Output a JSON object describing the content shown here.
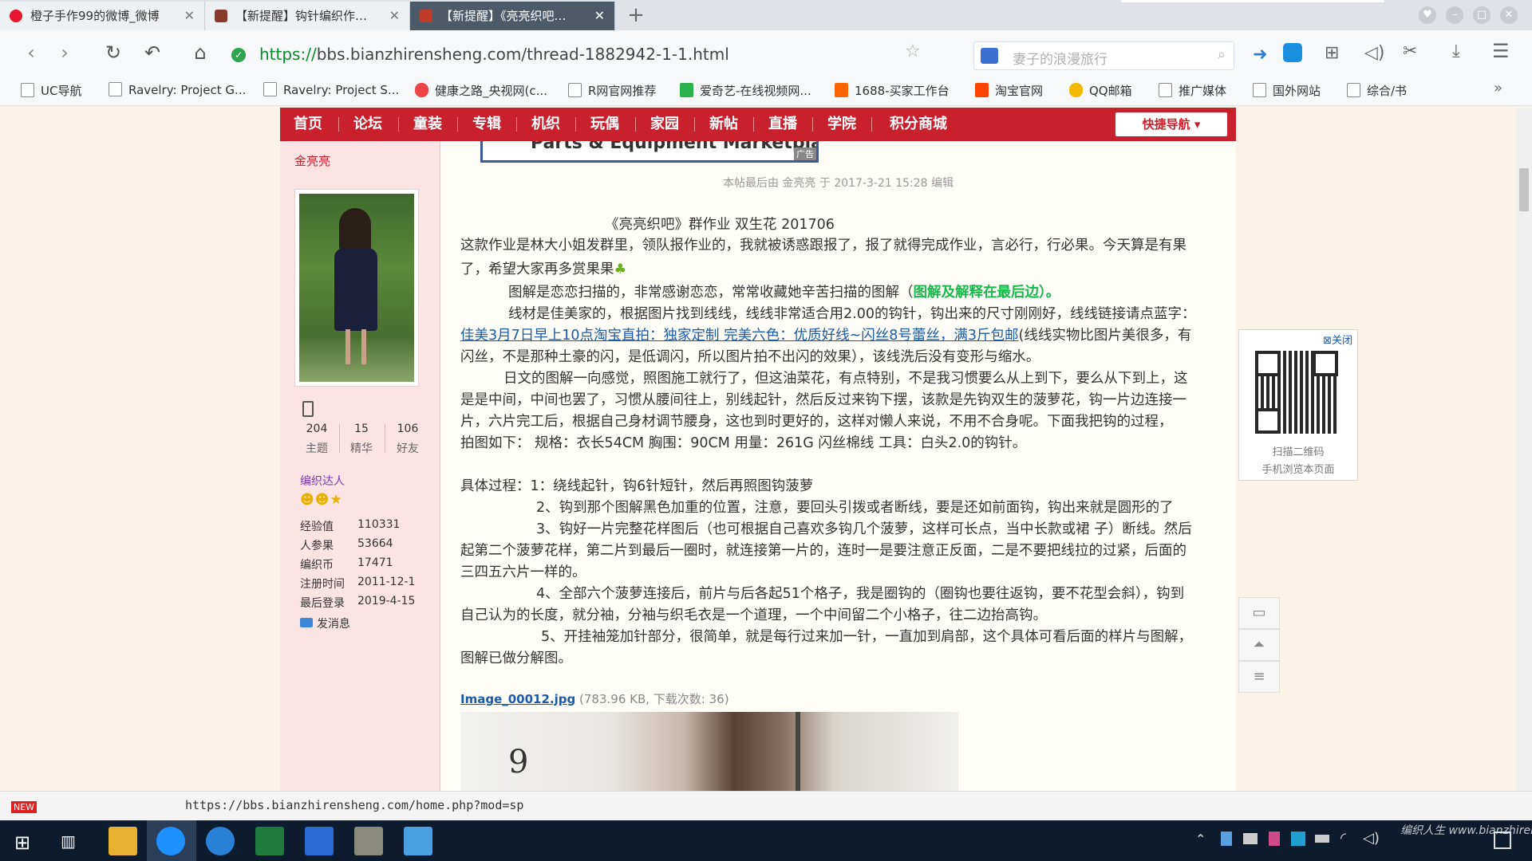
{
  "tabs": [
    {
      "label": "橙子手作99的微博_微博",
      "active": false
    },
    {
      "label": "【新提醒】钩针编织作…",
      "active": false
    },
    {
      "label": "【新提醒】《亮亮织吧…",
      "active": true
    }
  ],
  "address": {
    "scheme": "https://",
    "host_path": "bbs.bianzhirensheng.com/thread-1882942-1-1.html"
  },
  "search": {
    "placeholder": "妻子的浪漫旅行"
  },
  "bookmarks": [
    "UC导航",
    "Ravelry: Project G...",
    "Ravelry: Project S...",
    "健康之路_央视网(c...",
    "R网官网推荐",
    "爱奇艺-在线视频网...",
    "1688-买家工作台",
    "淘宝官网",
    "QQ邮箱",
    "推广媒体",
    "国外网站",
    "综合/书"
  ],
  "site_nav": {
    "items": [
      "首页",
      "论坛",
      "童装",
      "专辑",
      "机织",
      "玩偶",
      "家园",
      "新帖",
      "直播",
      "学院",
      "积分商城"
    ],
    "quick_nav": "快捷导航"
  },
  "ad_banner": {
    "text": "Parts & Equipment Marketplace",
    "tag": "广告"
  },
  "author": {
    "name": "金亮亮",
    "stats": [
      {
        "value": "204",
        "label": "主题"
      },
      {
        "value": "15",
        "label": "精华"
      },
      {
        "value": "106",
        "label": "好友"
      }
    ],
    "rank": "编织达人",
    "fields": [
      {
        "k": "经验值",
        "v": "110331"
      },
      {
        "k": "人参果",
        "v": "53664"
      },
      {
        "k": "编织币",
        "v": "17471"
      },
      {
        "k": "注册时间",
        "v": "2011-12-1"
      },
      {
        "k": "最后登录",
        "v": "2019-4-15"
      }
    ],
    "message": "发消息"
  },
  "post": {
    "edited": "本帖最后由 金亮亮 于 2017-3-21 15:28 编辑",
    "title": "《亮亮织吧》群作业 双生花  201706",
    "p1a": "这款作业是林大小姐发群里，领队报作业的，我就被诱惑跟报了，报了就得完成作业，言必行，行必果。今天算是有果",
    "p1b": "了，希望大家再多赏果果",
    "p2a": "图解是恋恋扫描的，非常感谢恋恋，常常收藏她辛苦扫描的图解（",
    "p2b": "图解及解释在最后边）。",
    "p3a": "线材是佳美家的，根据图片找到线线，线线非常适合用2.00的钩针，钩出来的尺寸刚刚好，线线链接请点蓝字：",
    "p3link": "佳美3月7日早上10点淘宝直拍：独家定制 完美六色：优质好线~闪丝8号蕾丝，满3斤包邮",
    "p3b": "(线线实物比图片美很多，有",
    "p3c": "闪丝，不是那种土豪的闪，是低调闪，所以图片拍不出闪的效果），该线洗后没有变形与缩水。",
    "p4a": "日文的图解一向感觉，照图施工就行了，但这油菜花，有点特别，不是我习惯要么从上到下，要么从下到上，这",
    "p4b": "是是中间，中间也罢了，习惯从腰间往上，别线起针，然后反过来钩下摆，该款是先钩双生的菠萝花，钩一片边连接一",
    "p4c": "片，六片完工后，根据自己身材调节腰身，这也到时更好的，这样对懒人来说，不用不合身呢。下面我把钩的过程，",
    "p4d": "拍图如下：        规格：衣长54CM   胸围：90CM              用量：261G 闪丝棉线            工具：白头2.0的钩针。",
    "s1": "具体过程：1：绕线起针，钩6针短针，然后再照图钩菠萝",
    "s2": "2、钩到那个图解黑色加重的位置，注意，要回头引拨或者断线，要是还如前面钩，钩出来就是圆形的了",
    "s3a": "3、钩好一片完整花样图后（也可根据自己喜欢多钩几个菠萝，这样可长点，当中长款或裙 子）断线。然后",
    "s3b": "起第二个菠萝花样，第二片到最后一圈时，就连接第一片的，连时一是要注意正反面，二是不要把线拉的过紧，后面的",
    "s3c": "三四五六片一样的。",
    "s4a": "4、全部六个菠萝连接后，前片与后各起51个格子，我是圈钩的（圈钩也要往返钩，要不花型会斜），钩到",
    "s4b": "自己认为的长度，就分袖，分袖与织毛衣是一个道理，一个中间留二个小格子，往二边抬高钩。",
    "s5a": "5、开挂袖笼加针部分，很简单，就是每行过来加一针，一直加到肩部，这个具体可看后面的样片与图解，",
    "s5b": "图解已做分解图。",
    "attach_name": "Image_00012.jpg",
    "attach_meta": "(783.96 KB, 下载次数: 36)",
    "photo_number": "9"
  },
  "qr": {
    "close": "关闭",
    "line1": "扫描二维码",
    "line2": "手机浏览本页面"
  },
  "status": {
    "badge": "NEW",
    "url": "https://bbs.bianzhirensheng.com/home.php?mod=sp"
  },
  "watermark": "编织人生 www.bianzhirensheng.com",
  "colors": {
    "site_red": "#c8202d",
    "sidebar_pink": "#fce3e4",
    "link_blue": "#1a5aa8",
    "highlight_green": "#18b84a"
  }
}
